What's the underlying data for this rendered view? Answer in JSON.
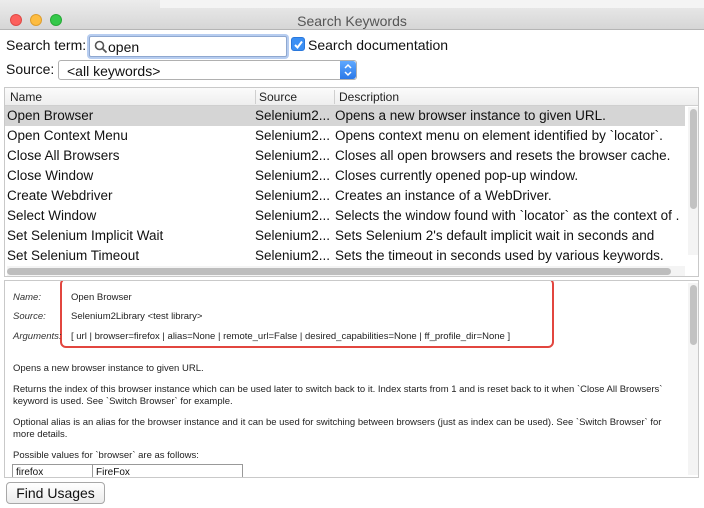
{
  "window": {
    "title": "Search Keywords"
  },
  "search": {
    "label": "Search term:",
    "value": "open",
    "doc_label": "Search documentation",
    "doc_checked": true
  },
  "source": {
    "label": "Source:",
    "selected": "<all keywords>"
  },
  "table": {
    "columns": [
      "Name",
      "Source",
      "Description"
    ],
    "rows": [
      {
        "name": "Open Browser",
        "source": "Selenium2...",
        "description": "Opens a new browser instance to given URL."
      },
      {
        "name": "Open Context Menu",
        "source": "Selenium2...",
        "description": "Opens context menu on element identified by `locator`."
      },
      {
        "name": "Close All Browsers",
        "source": "Selenium2...",
        "description": "Closes all open browsers and resets the browser cache."
      },
      {
        "name": "Close Window",
        "source": "Selenium2...",
        "description": "Closes currently opened pop-up window."
      },
      {
        "name": "Create Webdriver",
        "source": "Selenium2...",
        "description": "Creates an instance of a WebDriver."
      },
      {
        "name": "Select Window",
        "source": "Selenium2...",
        "description": "Selects the window found with `locator` as the context of ."
      },
      {
        "name": "Set Selenium Implicit Wait",
        "source": "Selenium2...",
        "description": "Sets Selenium 2's default implicit wait in seconds and"
      },
      {
        "name": "Set Selenium Timeout",
        "source": "Selenium2...",
        "description": "Sets the timeout in seconds used by various keywords."
      }
    ]
  },
  "doc": {
    "name_label": "Name:",
    "name_value": "Open Browser",
    "source_label": "Source:",
    "source_value": "Selenium2Library <test library>",
    "args_label": "Arguments:",
    "args_value": "[ url | browser=firefox | alias=None | remote_url=False | desired_capabilities=None | ff_profile_dir=None ]",
    "para1": "Opens a new browser instance to given URL.",
    "para2": "Returns the index of this browser instance which can be used later to switch back to it. Index starts from 1 and is reset back to it when `Close All Browsers` keyword is used. See `Switch Browser` for example.",
    "para3": "Optional alias is an alias for the browser instance and it can be used for switching between browsers (just as index can be used). See `Switch Browser` for more details.",
    "para4": "Possible values for `browser` are as follows:",
    "browser_table": [
      [
        "firefox",
        "FireFox"
      ]
    ]
  },
  "buttons": {
    "find_usages": "Find Usages"
  },
  "colors": {
    "highlight": "#e2463f",
    "selected_row": "#d5d5d5",
    "accent": "#3b8ff4"
  }
}
